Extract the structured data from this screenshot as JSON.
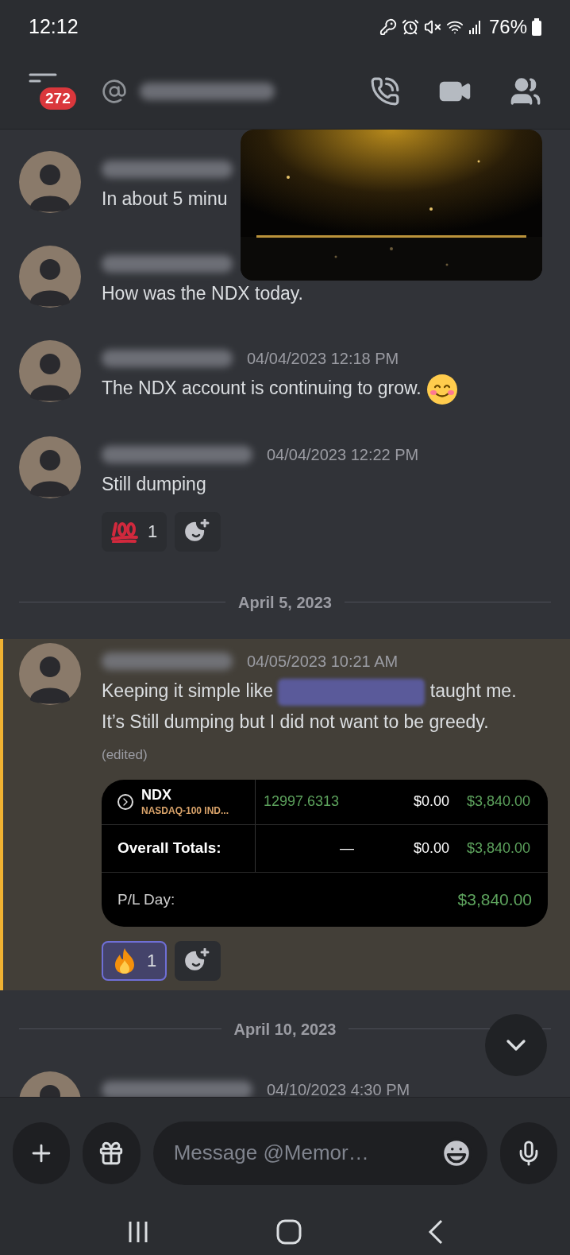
{
  "status_bar": {
    "time": "12:12",
    "battery": "76%"
  },
  "header": {
    "unread_badge": "272"
  },
  "timeline": [
    {
      "kind": "message",
      "highlighted": false,
      "segments": [
        {
          "kind": "text",
          "text": "In about 5 minu"
        }
      ]
    },
    {
      "kind": "message",
      "highlighted": false,
      "segments": [
        {
          "kind": "text",
          "text": "How was the NDX today."
        }
      ]
    },
    {
      "kind": "message",
      "highlighted": false,
      "timestamp": "04/04/2023 12:18 PM",
      "segments": [
        {
          "kind": "text",
          "text": "The NDX account is continuing to grow."
        },
        {
          "kind": "emoji"
        }
      ]
    },
    {
      "kind": "message",
      "highlighted": false,
      "timestamp": "04/04/2023 12:22 PM",
      "segments": [
        {
          "kind": "text",
          "text": "Still dumping"
        }
      ],
      "reactions": [
        {
          "kind": "hundred",
          "count": "1",
          "selected": false
        }
      ]
    },
    {
      "kind": "divider",
      "label": "April 5, 2023"
    },
    {
      "kind": "message",
      "highlighted": true,
      "timestamp": "04/05/2023 10:21 AM",
      "segments": [
        {
          "kind": "text",
          "text": "Keeping it simple like "
        },
        {
          "kind": "mention"
        },
        {
          "kind": "text",
          "text": " taught me. It’s Still dumping but I did not want to be greedy. "
        },
        {
          "kind": "edited",
          "text": "(edited)"
        }
      ],
      "embed": {
        "rows": [
          {
            "kind": "symbol",
            "symbol": "NDX",
            "subtitle": "NASDAQ-100 IND...",
            "price": "12997.6313",
            "change": "$0.00",
            "value": "$3,840.00"
          },
          {
            "kind": "totals",
            "label": "Overall Totals:",
            "price": "—",
            "change": "$0.00",
            "value": "$3,840.00"
          },
          {
            "kind": "pl",
            "label": "P/L Day:",
            "value": "$3,840.00"
          }
        ]
      },
      "reactions": [
        {
          "kind": "fire",
          "count": "1",
          "selected": true
        }
      ]
    },
    {
      "kind": "divider",
      "label": "April 10, 2023"
    },
    {
      "kind": "message",
      "highlighted": false,
      "timestamp": "04/10/2023 4:30 PM"
    }
  ],
  "composer": {
    "placeholder": "Message @Memor…"
  }
}
